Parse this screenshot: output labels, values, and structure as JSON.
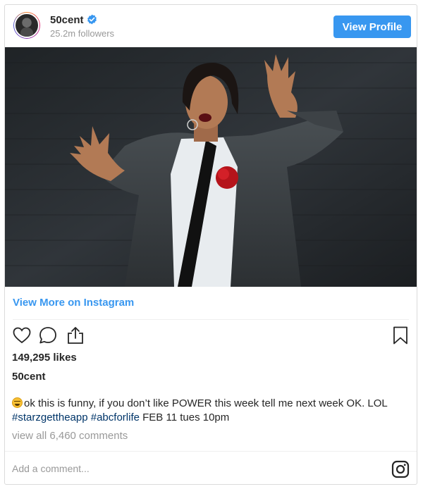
{
  "header": {
    "username": "50cent",
    "followers": "25.2m followers",
    "view_profile_label": "View Profile"
  },
  "post": {
    "view_more_label": "View More on Instagram",
    "likes": "149,295 likes",
    "caption_user": "50cent",
    "caption_text": "ok this is funny, if you don’t like POWER this week tell me next week OK. LOL",
    "hashtag_1": "#starzgettheapp",
    "hashtag_2": "#abcforlife",
    "caption_tail": "FEB 11 tues 10pm",
    "comments_label": "view all 6,460 comments"
  },
  "footer": {
    "add_comment_placeholder": "Add a comment..."
  },
  "icons": {
    "verified": "verified-badge-icon",
    "like": "heart-icon",
    "comment": "speech-bubble-icon",
    "share": "share-icon",
    "save": "bookmark-icon",
    "emoji": "grinning-squinting-face-emoji",
    "instagram": "instagram-logo-icon"
  },
  "colors": {
    "accent": "#3897f0",
    "hashtag": "#003569",
    "muted": "#999999",
    "text": "#262626"
  }
}
